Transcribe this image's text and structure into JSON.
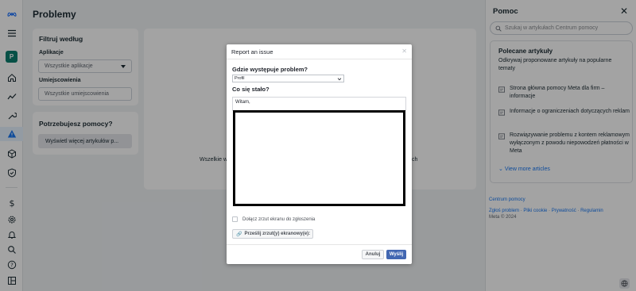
{
  "page": {
    "title": "Problemy"
  },
  "rail": {
    "avatar_letter": "P",
    "items": [
      "meta-logo-icon",
      "menu-icon",
      "avatar",
      "home-icon",
      "chart-icon",
      "wrench-icon",
      "warning-icon",
      "cube-icon",
      "shield-icon",
      "dollar-icon",
      "settings-icon",
      "bell-icon",
      "search-icon",
      "help-icon",
      "layout-icon"
    ],
    "accent": "#1877f2"
  },
  "filters": {
    "title": "Filtruj według",
    "apps_label": "Aplikacje",
    "apps_value": "Wszystkie aplikacje",
    "placements_label": "Umiejscowienia",
    "placements_value": "Wszystkie umiejscowienia"
  },
  "help_card": {
    "title": "Potrzebujesz pomocy?",
    "button": "Wyświetl więcej artykułów p..."
  },
  "main_empty": {
    "left_fragment": "Wszelkie w",
    "right_fragment": "ch"
  },
  "help_panel": {
    "title": "Pomoc",
    "search_placeholder": "Szukaj w artykułach Centrum pomocy",
    "recommended_title": "Polecane artykuły",
    "recommended_sub": "Odkrywaj proponowane artykuły na popularne tematy",
    "articles": [
      "Strona główna pomocy Meta dla firm – informacje",
      "Informacje o ograniczeniach dotyczących reklam",
      "Rozwiązywanie problemu z kontem reklamowym wyłączonym z powodu niepowodzeń płatności w Meta"
    ],
    "view_more": "View more articles",
    "center_link": "Centrum pomocy",
    "footer_links": [
      "Zgłoś problem",
      "Pliki cookie",
      "Prywatność",
      "Regulamin"
    ],
    "copyright": "Meta © 2024"
  },
  "modal": {
    "title": "Report an issue",
    "where_label": "Gdzie występuje problem?",
    "where_value": "Profil",
    "what_label": "Co się stało?",
    "message": "Witam,",
    "attach_label": "Dołącz zrzut ekranu do zgłoszenia",
    "upload_label": "Prześlij zrzut(y) ekranowy(e):",
    "cancel": "Anuluj",
    "send": "Wyślij",
    "send_color": "#4267b2"
  }
}
